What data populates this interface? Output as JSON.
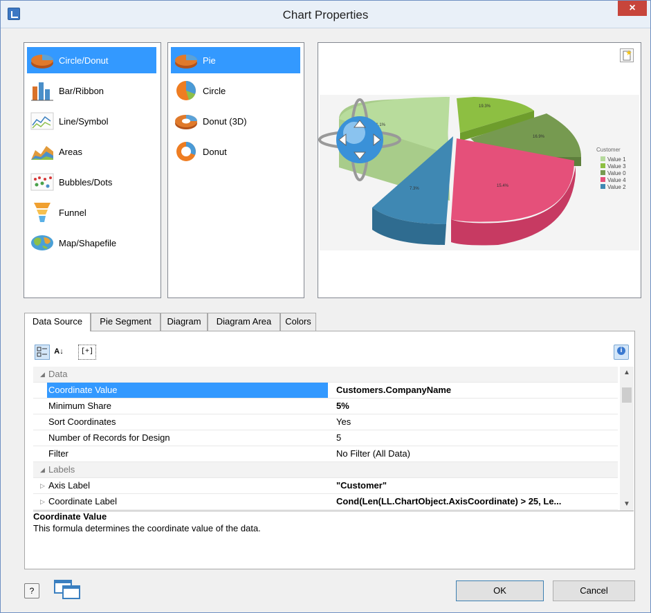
{
  "window": {
    "title": "Chart Properties",
    "close_label": "×"
  },
  "chart_types": [
    {
      "label": "Circle/Donut",
      "icon": "pie-chart-icon",
      "selected": true
    },
    {
      "label": "Bar/Ribbon",
      "icon": "bar-chart-icon",
      "selected": false
    },
    {
      "label": "Line/Symbol",
      "icon": "line-chart-icon",
      "selected": false
    },
    {
      "label": "Areas",
      "icon": "area-chart-icon",
      "selected": false
    },
    {
      "label": "Bubbles/Dots",
      "icon": "bubble-chart-icon",
      "selected": false
    },
    {
      "label": "Funnel",
      "icon": "funnel-icon",
      "selected": false
    },
    {
      "label": "Map/Shapefile",
      "icon": "map-icon",
      "selected": false
    }
  ],
  "chart_subtypes": [
    {
      "label": "Pie",
      "icon": "pie-3d-icon",
      "selected": true
    },
    {
      "label": "Circle",
      "icon": "circle-chart-icon",
      "selected": false
    },
    {
      "label": "Donut (3D)",
      "icon": "donut-3d-icon",
      "selected": false
    },
    {
      "label": "Donut",
      "icon": "donut-icon",
      "selected": false
    }
  ],
  "preview": {
    "legend_title": "Customer",
    "legend": [
      {
        "label": "Value 1",
        "color": "#b5d99c"
      },
      {
        "label": "Value 3",
        "color": "#8dbf42"
      },
      {
        "label": "Value 0",
        "color": "#769a50"
      },
      {
        "label": "Value 4",
        "color": "#e5507a"
      },
      {
        "label": "Value 2",
        "color": "#3f88b3"
      }
    ],
    "slice_labels": [
      "19.3%",
      "16.9%",
      "15.4%",
      "7.3%",
      "41.1%"
    ]
  },
  "tabs": [
    {
      "label": "Data Source",
      "active": true
    },
    {
      "label": "Pie Segment",
      "active": false
    },
    {
      "label": "Diagram",
      "active": false
    },
    {
      "label": "Diagram Area",
      "active": false
    },
    {
      "label": "Colors",
      "active": false
    }
  ],
  "toolbar": {
    "categorized_icon": "categorized-icon",
    "sort_label": "A↓",
    "expand_label": "[+]"
  },
  "grid": {
    "categories": {
      "data": "Data",
      "labels": "Labels"
    },
    "rows": [
      {
        "name": "Coordinate Value",
        "value": "Customers.CompanyName",
        "bold": true
      },
      {
        "name": "Minimum Share",
        "value": "5%",
        "bold": true
      },
      {
        "name": "Sort Coordinates",
        "value": "Yes",
        "bold": false
      },
      {
        "name": "Number of Records for Design",
        "value": "5",
        "bold": false
      },
      {
        "name": "Filter",
        "value": "No Filter (All Data)",
        "bold": false
      },
      {
        "name": "Axis Label",
        "value": "\"Customer\"",
        "bold": true
      },
      {
        "name": "Coordinate Label",
        "value": "Cond(Len(LL.ChartObject.AxisCoordinate) > 25, Le...",
        "bold": true
      }
    ]
  },
  "description": {
    "title": "Coordinate Value",
    "body": "This formula determines the coordinate value of the data."
  },
  "buttons": {
    "ok": "OK",
    "cancel": "Cancel",
    "help": "?"
  }
}
